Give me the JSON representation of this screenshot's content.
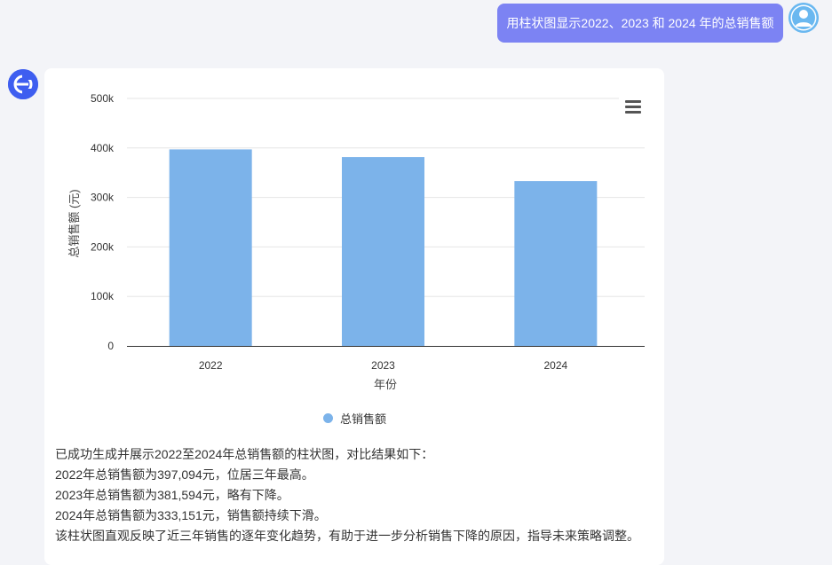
{
  "user_message": "用柱状图显示2022、2023 和 2024 年的总销售额",
  "chart_data": {
    "type": "bar",
    "categories": [
      "2022",
      "2023",
      "2024"
    ],
    "series": [
      {
        "name": "总销售额",
        "values": [
          397094,
          381594,
          333151
        ]
      }
    ],
    "xlabel": "年份",
    "ylabel": "总销售额 (元)",
    "ylim": [
      0,
      500000
    ],
    "yticks": [
      {
        "value": 0,
        "label": "0"
      },
      {
        "value": 100000,
        "label": "100k"
      },
      {
        "value": 200000,
        "label": "200k"
      },
      {
        "value": 300000,
        "label": "300k"
      },
      {
        "value": 400000,
        "label": "400k"
      },
      {
        "value": 500000,
        "label": "500k"
      }
    ],
    "grid": true,
    "legend_position": "bottom-center",
    "bar_color": "#7cb3ea"
  },
  "legend_label": "总销售额",
  "response_lines": [
    "已成功生成并展示2022至2024年总销售额的柱状图，对比结果如下：",
    "2022年总销售额为397,094元，位居三年最高。",
    "2023年总销售额为381,594元，略有下降。",
    "2024年总销售额为333,151元，销售额持续下滑。",
    "该柱状图直观反映了近三年销售的逐年变化趋势，有助于进一步分析销售下降的原因，指导未来策略调整。"
  ],
  "colors": {
    "user_bubble": "#7c83f3",
    "bot_avatar": "#3e5ef0",
    "user_avatar": "#6ab8f0",
    "page_bg": "#f3f4f8"
  },
  "icons": {
    "user_avatar": "user-avatar-icon",
    "bot_avatar": "bot-logo-icon",
    "chart_menu": "hamburger-menu-icon"
  }
}
